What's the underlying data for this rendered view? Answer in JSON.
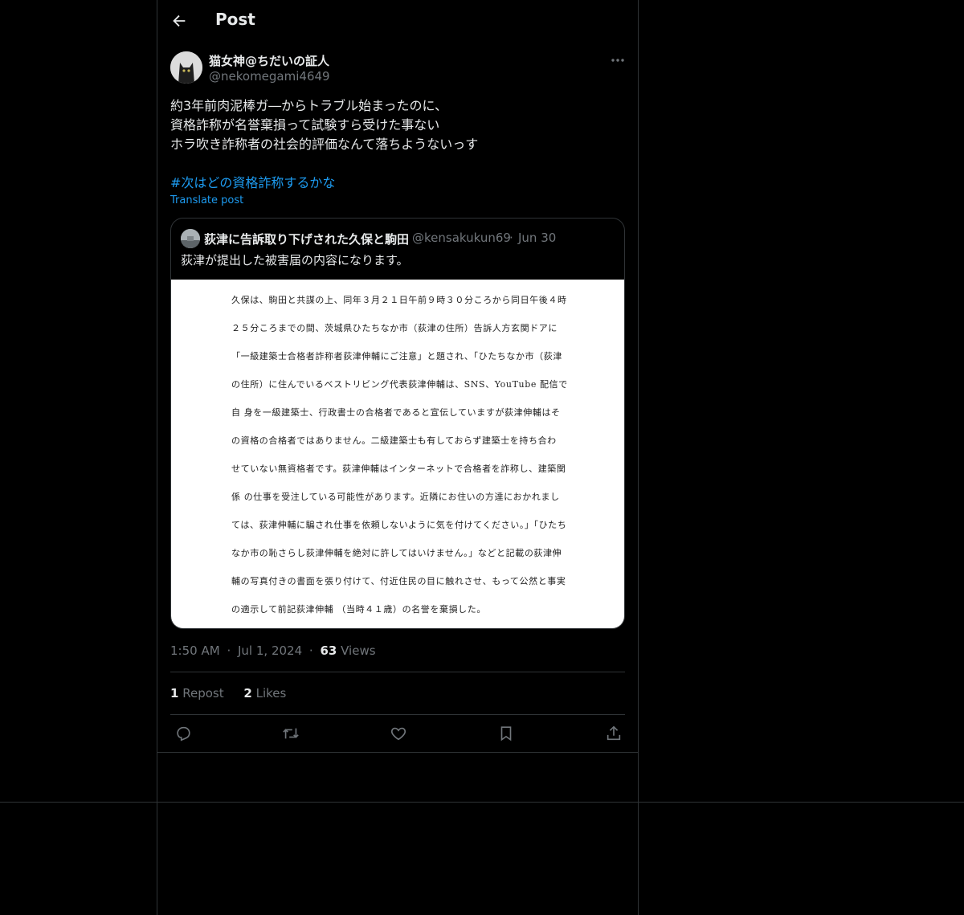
{
  "header": {
    "title": "Post"
  },
  "author": {
    "name": "猫女神@ちだいの証人",
    "handle": "@nekomegami4649"
  },
  "post": {
    "lines": [
      "約3年前肉泥棒ガ―からトラブル始まったのに、",
      "資格詐称が名誉棄損って試験すら受けた事ない",
      "ホラ吹き詐称者の社会的評価なんて落ちようないっす"
    ],
    "hashtag": "#次はどの資格詐称するかな",
    "translate_label": "Translate post"
  },
  "quote": {
    "name": "荻津に告訴取り下げされた久保と駒田",
    "handle": "@kensakukun69",
    "separator": "·",
    "date": "Jun 30",
    "text": "荻津が提出した被害届の内容になります。",
    "document_lines": [
      "久保は、駒田と共謀の上、同年３月２１日午前９時３０分ころから同日午後４時",
      "２５分ころまでの間、茨城県ひたちなか市（荻津の住所）告訴人方玄関ドアに",
      "「一級建築士合格者詐称者荻津伸輔にご注意」と題され、「ひたちなか市（荻津",
      "の住所）に住んでいるベストリビング代表荻津伸輔は、SNS、YouTube 配信で",
      "自 身を一級建築士、行政書士の合格者であると宣伝していますが荻津伸輔はそ",
      "の資格の合格者ではありません。二級建築士も有しておらず建築士を持ち合わ",
      "せていない無資格者です。荻津伸輔はインターネットで合格者を詐称し、建築関",
      "係 の仕事を受注している可能性があります。近隣にお住いの方達におかれまし",
      "ては、荻津伸輔に騙され仕事を依頼しないように気を付けてください。」「ひたち",
      "なか市の恥さらし荻津伸輔を絶対に許してはいけません。」などと記載の荻津伸",
      "輔の写真付きの書面を張り付けて、付近住民の目に触れさせ、もって公然と事実",
      "の適示して前記荻津伸輔 （当時４１歳）の名誉を棄損した。"
    ]
  },
  "meta": {
    "time": "1:50 AM",
    "sep1": "·",
    "date": "Jul 1, 2024",
    "sep2": "·",
    "views_count": "63",
    "views_label": "Views"
  },
  "stats": {
    "reposts_count": "1",
    "reposts_label": "Repost",
    "likes_count": "2",
    "likes_label": "Likes"
  },
  "icons": {
    "back": "back-arrow-icon",
    "more": "more-icon",
    "reply": "reply-icon",
    "repost": "repost-icon",
    "like": "like-icon",
    "bookmark": "bookmark-icon",
    "share": "share-icon"
  },
  "colors": {
    "background": "#000000",
    "text": "#e7e9ea",
    "muted": "#71767b",
    "accent": "#1d9bf0",
    "border": "#2f3336"
  }
}
